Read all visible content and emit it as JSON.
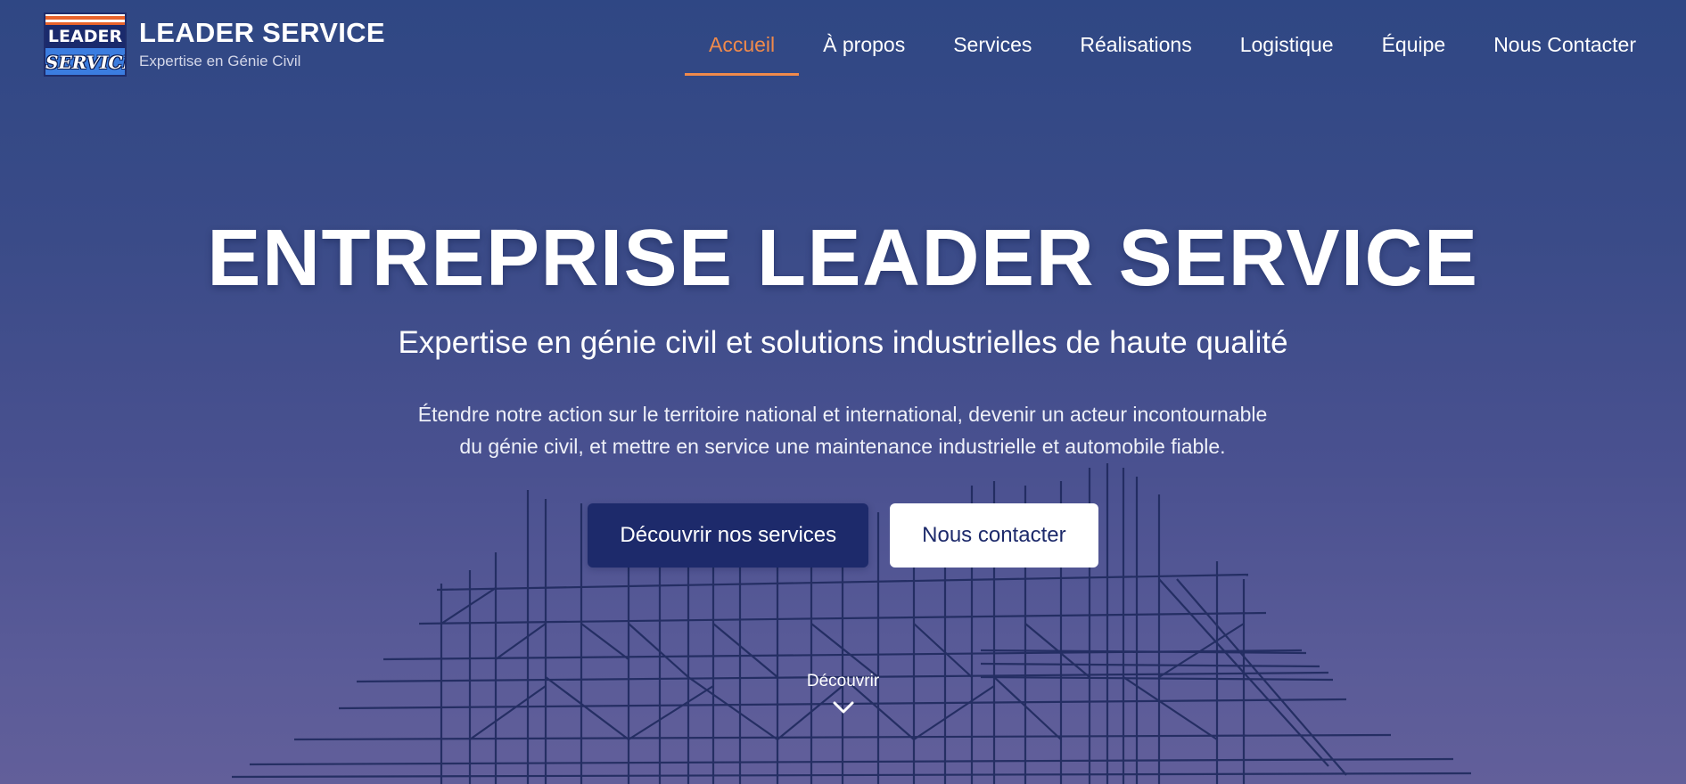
{
  "brand": {
    "logo_top": "LEADER",
    "logo_bottom": "SERVICE",
    "title": "LEADER SERVICE",
    "subtitle": "Expertise en Génie Civil"
  },
  "nav": {
    "items": [
      {
        "label": "Accueil",
        "active": true
      },
      {
        "label": "À propos",
        "active": false
      },
      {
        "label": "Services",
        "active": false
      },
      {
        "label": "Réalisations",
        "active": false
      },
      {
        "label": "Logistique",
        "active": false
      },
      {
        "label": "Équipe",
        "active": false
      },
      {
        "label": "Nous Contacter",
        "active": false
      }
    ],
    "active_color": "#f08a4b"
  },
  "hero": {
    "title": "ENTREPRISE LEADER SERVICE",
    "subtitle": "Expertise en génie civil et solutions industrielles de haute qualité",
    "description_line1": "Étendre notre action sur le territoire national et international, devenir un acteur incontournable",
    "description_line2": "du génie civil, et mettre en service une maintenance industrielle et automobile fiable.",
    "primary_button": "Découvrir nos services",
    "secondary_button": "Nous contacter",
    "discover_label": "Découvrir",
    "discover_icon": "chevron-down-icon",
    "background_image": "scaffolding-structure"
  },
  "colors": {
    "background_top": "#2f4784",
    "background_bottom": "#625f9a",
    "primary_button": "#1d2a6b",
    "accent": "#f08a4b"
  }
}
